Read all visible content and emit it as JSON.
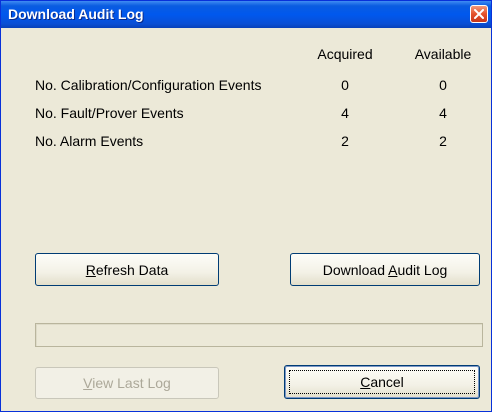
{
  "window": {
    "title": "Download Audit Log"
  },
  "table": {
    "headers": {
      "acquired": "Acquired",
      "available": "Available"
    },
    "rows": [
      {
        "label": "No. Calibration/Configuration Events",
        "acquired": "0",
        "available": "0"
      },
      {
        "label": "No. Fault/Prover Events",
        "acquired": "4",
        "available": "4"
      },
      {
        "label": "No. Alarm Events",
        "acquired": "2",
        "available": "2"
      }
    ]
  },
  "buttons": {
    "refresh": {
      "before": "",
      "accel": "R",
      "after": "efresh Data"
    },
    "download": {
      "before": "Download ",
      "accel": "A",
      "after": "udit Log"
    },
    "view_last": {
      "before": "",
      "accel": "V",
      "after": "iew Last Log"
    },
    "cancel": {
      "before": "",
      "accel": "C",
      "after": "ancel"
    }
  },
  "progress": {
    "value": 0
  },
  "colors": {
    "titlebar": "#0058ee",
    "dialog_bg": "#ece9d8",
    "close_button": "#e4512b",
    "disabled_text": "#aca899"
  },
  "icons": {
    "close": "close-x-icon"
  }
}
